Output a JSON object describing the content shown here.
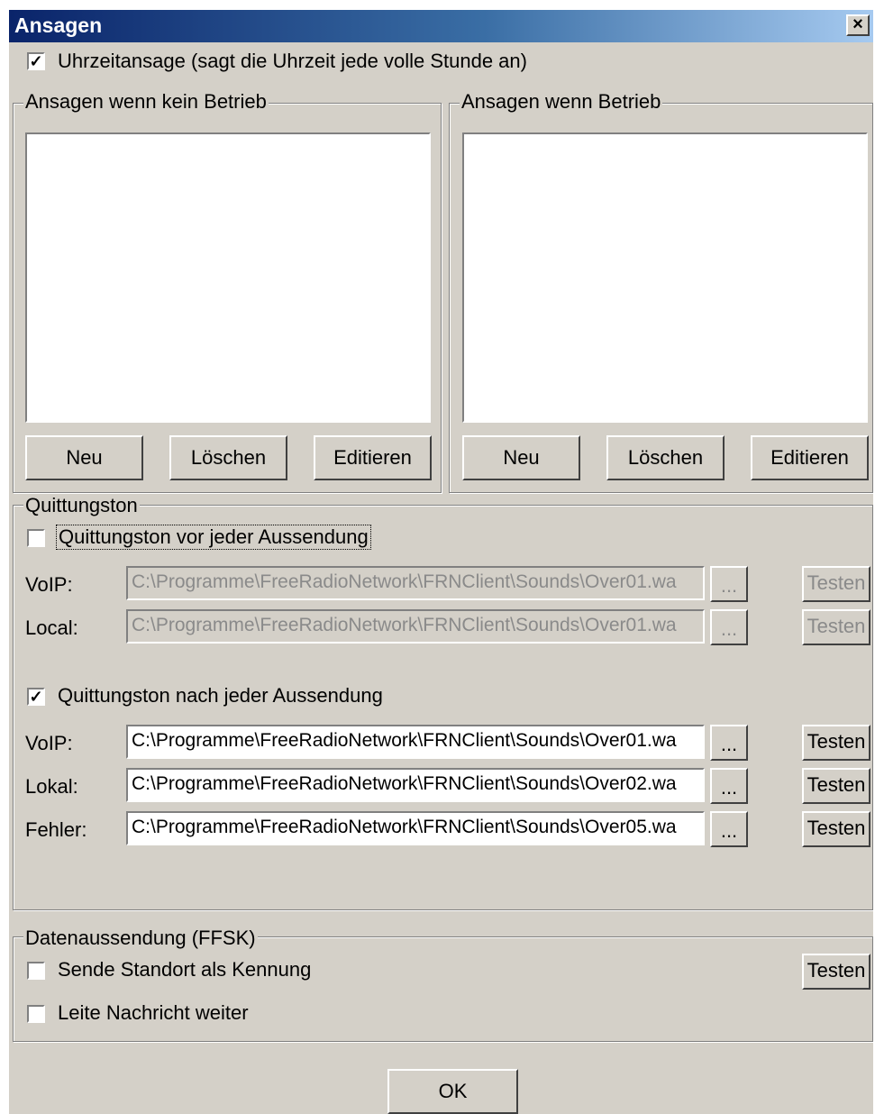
{
  "window": {
    "title": "Ansagen",
    "close_glyph": "×"
  },
  "time_announcement": {
    "checked_glyph": "✓",
    "label": "Uhrzeitansage (sagt die Uhrzeit jede volle Stunde an)"
  },
  "group_no_operation": {
    "legend": "Ansagen wenn kein Betrieb",
    "buttons": {
      "new": "Neu",
      "delete": "Löschen",
      "edit": "Editieren"
    }
  },
  "group_operation": {
    "legend": "Ansagen wenn Betrieb",
    "buttons": {
      "new": "Neu",
      "delete": "Löschen",
      "edit": "Editieren"
    }
  },
  "ack_tone": {
    "legend": "Quittungston",
    "before": {
      "label": "Quittungston vor jeder Aussendung",
      "checked_glyph": "",
      "rows": [
        {
          "label": "VoIP:",
          "path": "C:\\Programme\\FreeRadioNetwork\\FRNClient\\Sounds\\Over01.wa",
          "browse": "...",
          "test": "Testen"
        },
        {
          "label": "Local:",
          "path": "C:\\Programme\\FreeRadioNetwork\\FRNClient\\Sounds\\Over01.wa",
          "browse": "...",
          "test": "Testen"
        }
      ]
    },
    "after": {
      "label": "Quittungston nach jeder Aussendung",
      "checked_glyph": "✓",
      "rows": [
        {
          "label": "VoIP:",
          "path": "C:\\Programme\\FreeRadioNetwork\\FRNClient\\Sounds\\Over01.wa",
          "browse": "...",
          "test": "Testen"
        },
        {
          "label": "Lokal:",
          "path": "C:\\Programme\\FreeRadioNetwork\\FRNClient\\Sounds\\Over02.wa",
          "browse": "...",
          "test": "Testen"
        },
        {
          "label": "Fehler:",
          "path": "C:\\Programme\\FreeRadioNetwork\\FRNClient\\Sounds\\Over05.wa",
          "browse": "...",
          "test": "Testen"
        }
      ]
    }
  },
  "data_transmission": {
    "legend": "Datenaussendung (FFSK)",
    "send_location": {
      "label": "Sende Standort als Kennung",
      "checked_glyph": ""
    },
    "forward_message": {
      "label": "Leite Nachricht weiter",
      "checked_glyph": ""
    },
    "test": "Testen"
  },
  "ok_button": "OK"
}
